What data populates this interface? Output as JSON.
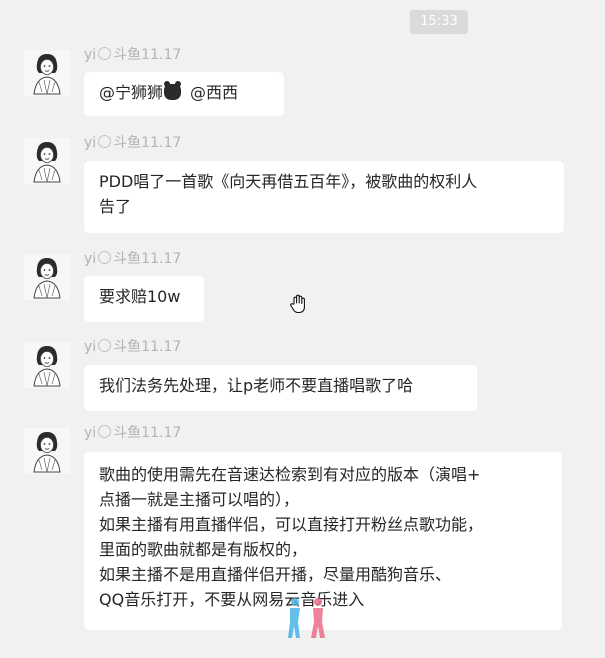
{
  "timestamp": "15:33",
  "sender_name": "yi",
  "sender_suffix": "斗鱼11.17",
  "watermark_text": "",
  "messages": [
    {
      "lines": [
        "@宁狮狮",
        "@西西"
      ]
    },
    {
      "lines": [
        "PDD唱了一首歌《向天再借五百年》，被歌曲的权利人",
        "告了"
      ]
    },
    {
      "lines": [
        "要求赔10w"
      ]
    },
    {
      "lines": [
        "我们法务先处理，让p老师不要直播唱歌了哈"
      ]
    },
    {
      "lines": [
        "歌曲的使用需先在音速达检索到有对应的版本（演唱+",
        "点播一就是主播可以唱的），",
        "如果主播有用直播伴侣，可以直接打开粉丝点歌功能，",
        "里面的歌曲就都是有版权的，",
        "如果主播不是用直播伴侣开播，尽量用酷狗音乐、",
        "QQ音乐打开，不要从网易云音乐进入"
      ]
    }
  ],
  "icons": {
    "avatar": "sketch-portrait-avatar",
    "cursor": "hand-pointer-icon",
    "emoji": "bear-emoji-icon"
  }
}
